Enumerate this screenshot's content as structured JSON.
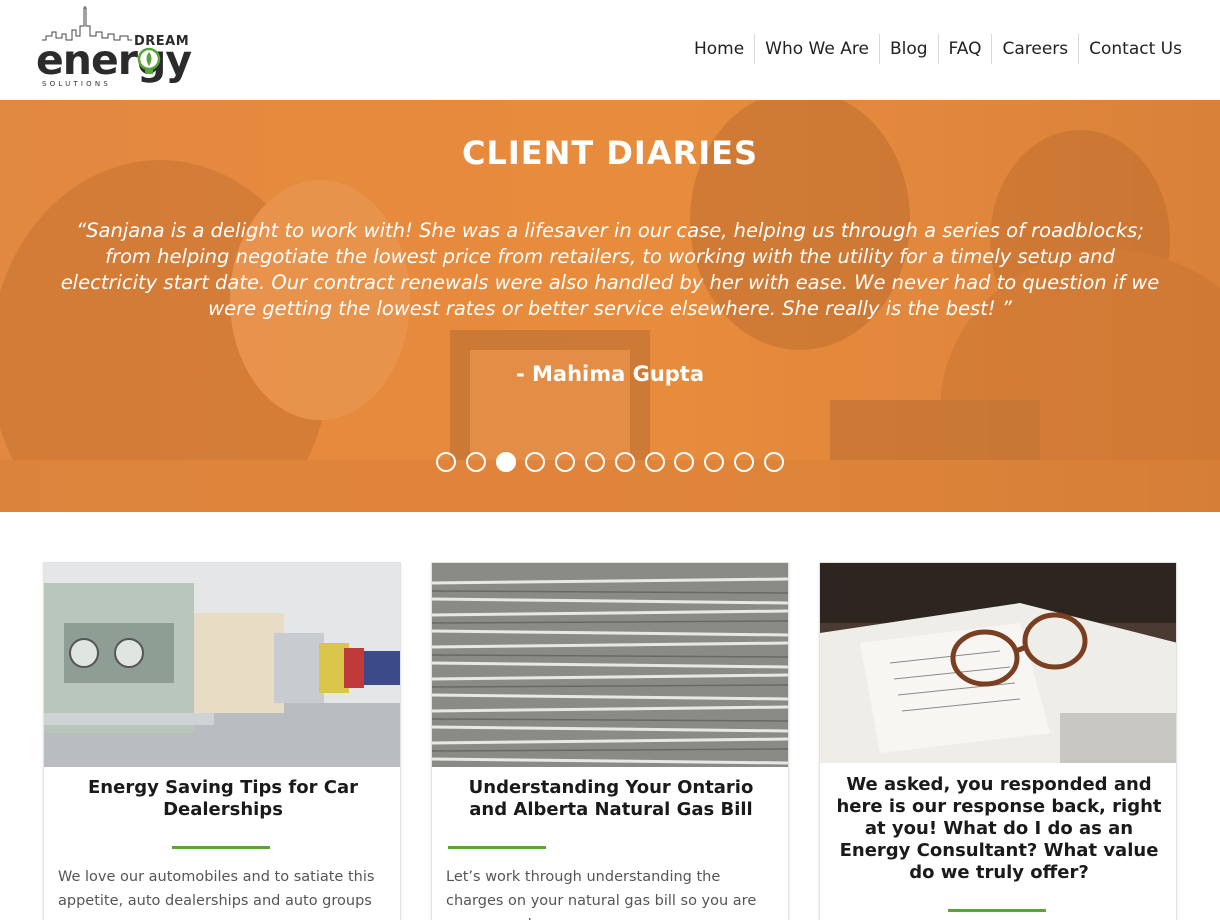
{
  "logo": {
    "top": "DREAM",
    "main": "energy",
    "sub": "SOLUTIONS"
  },
  "nav": [
    "Home",
    "Who We Are",
    "Blog",
    "FAQ",
    "Careers",
    "Contact Us"
  ],
  "hero": {
    "title": "CLIENT DIARIES",
    "quote": "“Sanjana is a delight to work with! She was a lifesaver in our case, helping us through a series of roadblocks; from helping negotiate the lowest price from retailers, to working with the utility for a timely setup and electricity start date. Our contract renewals were also handled by her with ease. We never had to question if we were getting the lowest rates or better service elsewhere. She really is the best! ”",
    "author": "- Mahima Gupta",
    "slides_total": 12,
    "active_slide": 3
  },
  "cards": [
    {
      "image": "classic cars in showroom",
      "title": "Energy Saving Tips for Car Dealerships",
      "excerpt": "We love our automobiles and to satiate this appetite, auto dealerships and auto groups"
    },
    {
      "image": "stacks of paper bills",
      "title": "Understanding Your Ontario and Alberta Natural Gas Bill",
      "excerpt": "Let’s work through understanding the charges on your natural gas bill so you are empowered"
    },
    {
      "image": "glasses on notebook",
      "title": "We asked, you responded and here is our response back, right at you! What do I do as an Energy Consultant? What value do we truly offer?",
      "excerpt": ""
    }
  ],
  "colors": {
    "accent_orange": "#e8863a",
    "accent_green": "#5aa53a"
  }
}
